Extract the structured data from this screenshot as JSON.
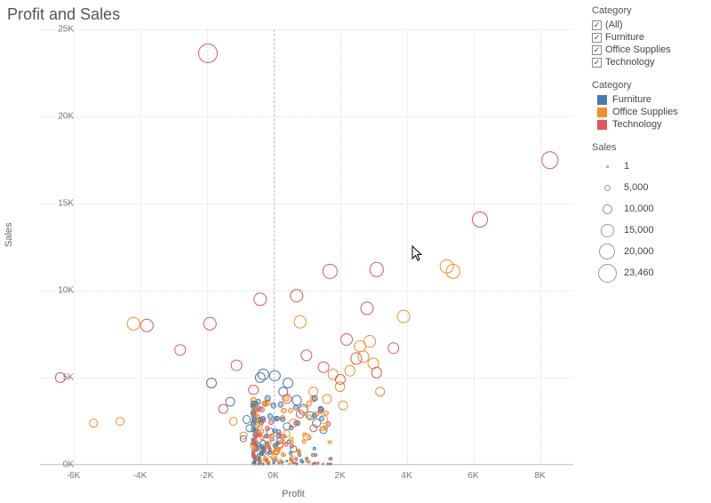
{
  "title": "Profit and Sales",
  "xlabel": "Profit",
  "ylabel": "Sales",
  "xticks": [
    "-6K",
    "-4K",
    "-2K",
    "0K",
    "2K",
    "4K",
    "6K",
    "8K"
  ],
  "yticks": [
    "0K",
    "5K",
    "10K",
    "15K",
    "20K",
    "25K"
  ],
  "filter": {
    "title": "Category",
    "items": [
      {
        "label": "(All)",
        "checked": true
      },
      {
        "label": "Furniture",
        "checked": true
      },
      {
        "label": "Office Supplies",
        "checked": true
      },
      {
        "label": "Technology",
        "checked": true
      }
    ]
  },
  "color_legend": {
    "title": "Category",
    "items": [
      {
        "label": "Furniture",
        "cls": "sw-fur"
      },
      {
        "label": "Office Supplies",
        "cls": "sw-off"
      },
      {
        "label": "Technology",
        "cls": "sw-tec"
      }
    ]
  },
  "size_legend": {
    "title": "Sales",
    "items": [
      {
        "label": "1",
        "d": 3
      },
      {
        "label": "5,000",
        "d": 7
      },
      {
        "label": "10,000",
        "d": 11
      },
      {
        "label": "15,000",
        "d": 15
      },
      {
        "label": "20,000",
        "d": 18
      },
      {
        "label": "23,460",
        "d": 21
      }
    ]
  },
  "chart_data": {
    "type": "scatter",
    "xlabel": "Profit",
    "ylabel": "Sales",
    "xlim": [
      -7000,
      9000
    ],
    "ylim": [
      0,
      25000
    ],
    "size_field": "Sales",
    "size_range": [
      1,
      23460
    ],
    "series": [
      {
        "name": "Furniture",
        "color": "#4b7aa8",
        "points": [
          {
            "x": -1850,
            "y": 4700
          },
          {
            "x": -400,
            "y": 5000
          },
          {
            "x": -1300,
            "y": 3600
          },
          {
            "x": -800,
            "y": 2600
          },
          {
            "x": -550,
            "y": 2300
          },
          {
            "x": -300,
            "y": 5200
          },
          {
            "x": 300,
            "y": 4200
          },
          {
            "x": 700,
            "y": 3700
          },
          {
            "x": 900,
            "y": 3200
          },
          {
            "x": 1100,
            "y": 2800
          },
          {
            "x": 1300,
            "y": 2400
          },
          {
            "x": 1500,
            "y": 2000
          },
          {
            "x": 200,
            "y": 1400
          },
          {
            "x": 600,
            "y": 900
          },
          {
            "x": 100,
            "y": 700
          },
          {
            "x": -200,
            "y": 900
          },
          {
            "x": -500,
            "y": 1800
          },
          {
            "x": -900,
            "y": 1500
          },
          {
            "x": 400,
            "y": 2200
          },
          {
            "x": 50,
            "y": 5100
          },
          {
            "x": 450,
            "y": 4700
          },
          {
            "x": -100,
            "y": 1900
          },
          {
            "x": -300,
            "y": 1200
          },
          {
            "x": -700,
            "y": 2100
          }
        ]
      },
      {
        "name": "Office Supplies",
        "color": "#f28e2c",
        "points": [
          {
            "x": -4200,
            "y": 8100
          },
          {
            "x": -5400,
            "y": 2400
          },
          {
            "x": -4600,
            "y": 2500
          },
          {
            "x": 800,
            "y": 8200
          },
          {
            "x": 5200,
            "y": 11400
          },
          {
            "x": 5400,
            "y": 11100
          },
          {
            "x": 3900,
            "y": 8500
          },
          {
            "x": 2600,
            "y": 6800
          },
          {
            "x": 1800,
            "y": 5200
          },
          {
            "x": 1200,
            "y": 4200
          },
          {
            "x": 900,
            "y": 3100
          },
          {
            "x": 600,
            "y": 2400
          },
          {
            "x": 400,
            "y": 1800
          },
          {
            "x": 200,
            "y": 1200
          },
          {
            "x": 100,
            "y": 800
          },
          {
            "x": -100,
            "y": 600
          },
          {
            "x": -300,
            "y": 400
          },
          {
            "x": -600,
            "y": 1100
          },
          {
            "x": -900,
            "y": 1700
          },
          {
            "x": -1200,
            "y": 2500
          },
          {
            "x": 1600,
            "y": 3800
          },
          {
            "x": 2000,
            "y": 4500
          },
          {
            "x": 2300,
            "y": 5400
          },
          {
            "x": 2700,
            "y": 6200
          },
          {
            "x": 3000,
            "y": 5800
          },
          {
            "x": 3200,
            "y": 4200
          },
          {
            "x": 1500,
            "y": 2600
          },
          {
            "x": 1000,
            "y": 1600
          },
          {
            "x": 2900,
            "y": 7100
          },
          {
            "x": 2100,
            "y": 3400
          }
        ]
      },
      {
        "name": "Technology",
        "color": "#e15759",
        "points": [
          {
            "x": -1950,
            "y": 23600
          },
          {
            "x": 8300,
            "y": 17500
          },
          {
            "x": 6200,
            "y": 14100
          },
          {
            "x": 1700,
            "y": 11100
          },
          {
            "x": 3100,
            "y": 11200
          },
          {
            "x": -6400,
            "y": 5000
          },
          {
            "x": -3800,
            "y": 8000
          },
          {
            "x": -1900,
            "y": 8100
          },
          {
            "x": -2800,
            "y": 6600
          },
          {
            "x": 700,
            "y": 9700
          },
          {
            "x": -400,
            "y": 9500
          },
          {
            "x": 2200,
            "y": 7200
          },
          {
            "x": 2800,
            "y": 9000
          },
          {
            "x": 1000,
            "y": 6300
          },
          {
            "x": 1500,
            "y": 5600
          },
          {
            "x": 2000,
            "y": 4900
          },
          {
            "x": 2500,
            "y": 6100
          },
          {
            "x": 3100,
            "y": 5300
          },
          {
            "x": -1100,
            "y": 5700
          },
          {
            "x": -600,
            "y": 4300
          },
          {
            "x": 400,
            "y": 3800
          },
          {
            "x": 800,
            "y": 2900
          },
          {
            "x": 1200,
            "y": 2100
          },
          {
            "x": 200,
            "y": 1100
          },
          {
            "x": -200,
            "y": 800
          },
          {
            "x": 3600,
            "y": 6700
          },
          {
            "x": -1500,
            "y": 3200
          }
        ]
      }
    ]
  },
  "cursor_pos": {
    "profit": 4150,
    "sales": 12600
  }
}
